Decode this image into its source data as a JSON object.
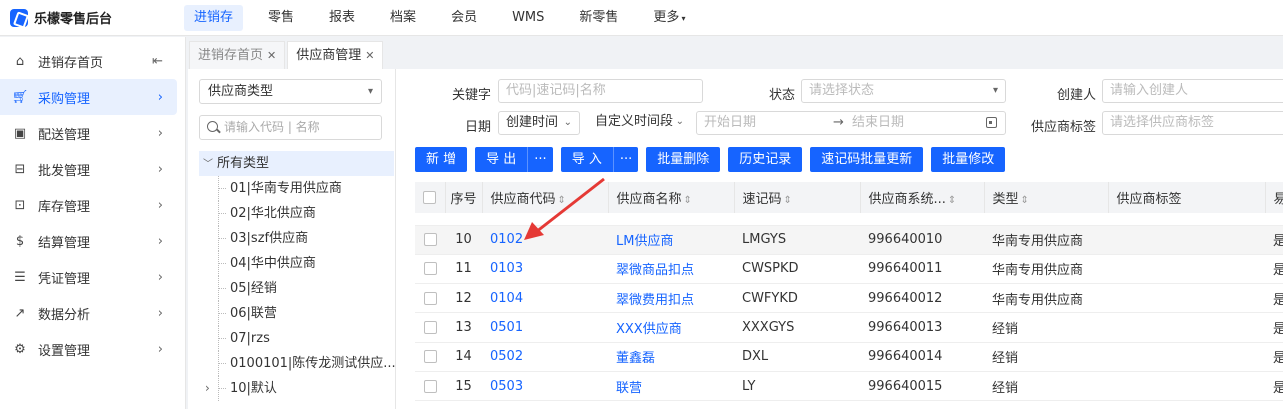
{
  "app": {
    "title": "乐檬零售后台",
    "accent": "#1664ff",
    "annotation_color": "#e53935"
  },
  "nav": {
    "items": [
      "进销存",
      "零售",
      "报表",
      "档案",
      "会员",
      "WMS",
      "新零售",
      "更多"
    ],
    "active_index": 0
  },
  "sidebar": {
    "items": [
      {
        "label": "进销存首页",
        "icon": "home-icon"
      },
      {
        "label": "采购管理",
        "icon": "cart-icon"
      },
      {
        "label": "配送管理",
        "icon": "truck-icon"
      },
      {
        "label": "批发管理",
        "icon": "wholesale-icon"
      },
      {
        "label": "库存管理",
        "icon": "inventory-icon"
      },
      {
        "label": "结算管理",
        "icon": "settlement-icon"
      },
      {
        "label": "凭证管理",
        "icon": "voucher-icon"
      },
      {
        "label": "数据分析",
        "icon": "analytics-icon"
      },
      {
        "label": "设置管理",
        "icon": "settings-icon"
      }
    ],
    "active_index": 1
  },
  "tabs": [
    {
      "label": "进销存首页",
      "active": false
    },
    {
      "label": "供应商管理",
      "active": true
    }
  ],
  "tree": {
    "type_select": "供应商类型",
    "search_placeholder": "请输入代码 | 名称",
    "root": "所有类型",
    "items": [
      "01|华南专用供应商",
      "02|华北供应商",
      "03|szf供应商",
      "04|华中供应商",
      "05|经销",
      "06|联营",
      "07|rzs",
      "0100101|陈传龙测试供应...",
      "10|默认"
    ]
  },
  "filters": {
    "keyword_label": "关键字",
    "keyword_placeholder": "代码|速记码|名称",
    "status_label": "状态",
    "status_placeholder": "请选择状态",
    "creator_label": "创建人",
    "creator_placeholder": "请输入创建人",
    "date_label": "日期",
    "date_type": "创建时间",
    "date_range": "自定义时间段",
    "start_placeholder": "开始日期",
    "range_arrow": "→",
    "end_placeholder": "结束日期",
    "tag_label": "供应商标签",
    "tag_placeholder": "请选择供应商标签"
  },
  "toolbar": {
    "new": "新 增",
    "export": "导 出",
    "import": "导 入",
    "more": "···",
    "batch_delete": "批量删除",
    "history": "历史记录",
    "batch_shortcode": "速记码批量更新",
    "batch_edit": "批量修改"
  },
  "table": {
    "headers": [
      "序号",
      "供应商代码",
      "供应商名称",
      "速记码",
      "供应商系统...",
      "类型",
      "供应商标签",
      "易"
    ],
    "rows": [
      {
        "no": "10",
        "code": "0102",
        "name": "LM供应商",
        "short": "LMGYS",
        "sys": "996640010",
        "type": "华南专用供应商",
        "tag": "",
        "extra": "是"
      },
      {
        "no": "11",
        "code": "0103",
        "name": "翠微商品扣点",
        "short": "CWSPKD",
        "sys": "996640011",
        "type": "华南专用供应商",
        "tag": "",
        "extra": "是"
      },
      {
        "no": "12",
        "code": "0104",
        "name": "翠微费用扣点",
        "short": "CWFYKD",
        "sys": "996640012",
        "type": "华南专用供应商",
        "tag": "",
        "extra": "是"
      },
      {
        "no": "13",
        "code": "0501",
        "name": "XXX供应商",
        "short": "XXXGYS",
        "sys": "996640013",
        "type": "经销",
        "tag": "",
        "extra": "是"
      },
      {
        "no": "14",
        "code": "0502",
        "name": "董鑫磊",
        "short": "DXL",
        "sys": "996640014",
        "type": "经销",
        "tag": "",
        "extra": "是"
      },
      {
        "no": "15",
        "code": "0503",
        "name": "联营",
        "short": "LY",
        "sys": "996640015",
        "type": "经销",
        "tag": "",
        "extra": "是"
      }
    ]
  }
}
